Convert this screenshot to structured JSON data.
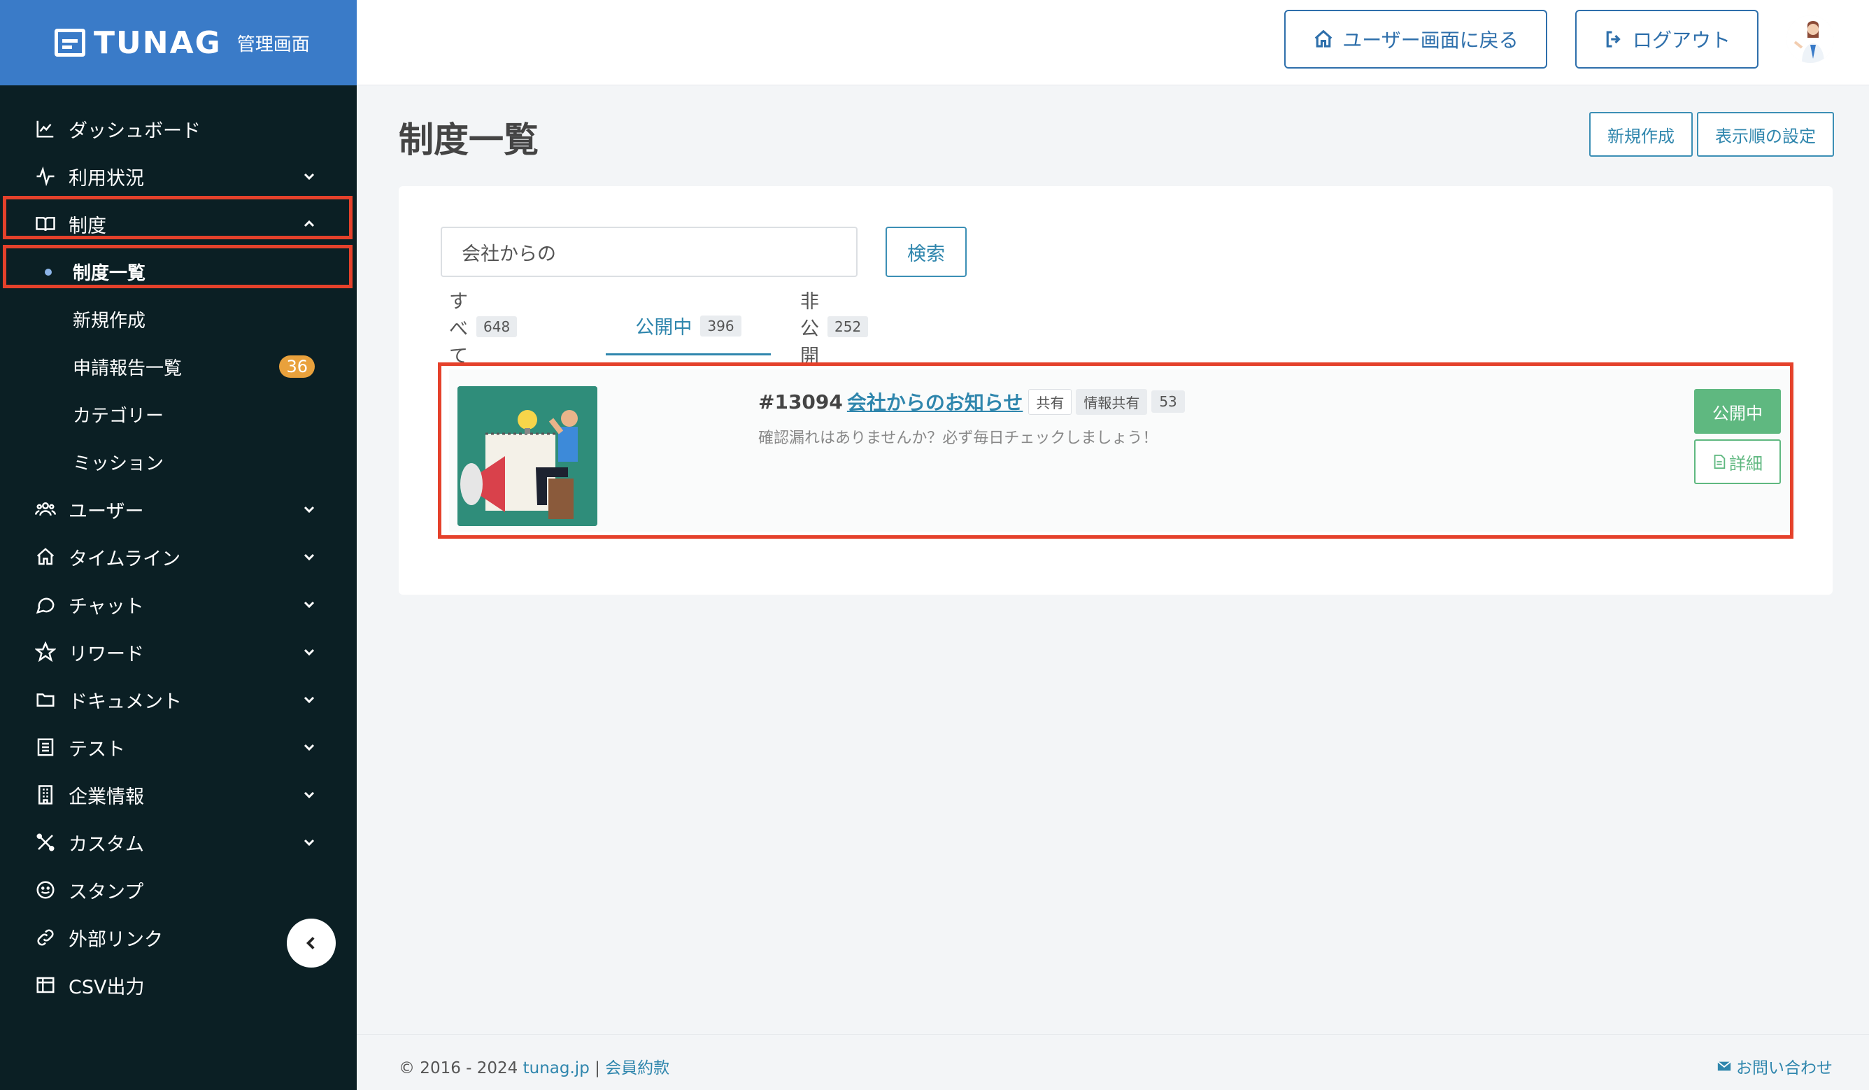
{
  "brand": {
    "name": "TUNAG",
    "subtitle": "管理画面"
  },
  "topbar": {
    "back_label": "ユーザー画面に戻る",
    "logout_label": "ログアウト"
  },
  "sidebar": {
    "items": [
      {
        "label": "ダッシュボード"
      },
      {
        "label": "利用状況"
      },
      {
        "label": "制度"
      },
      {
        "label": "制度一覧"
      },
      {
        "label": "新規作成"
      },
      {
        "label": "申請報告一覧",
        "badge": "36"
      },
      {
        "label": "カテゴリー"
      },
      {
        "label": "ミッション"
      },
      {
        "label": "ユーザー"
      },
      {
        "label": "タイムライン"
      },
      {
        "label": "チャット"
      },
      {
        "label": "リワード"
      },
      {
        "label": "ドキュメント"
      },
      {
        "label": "テスト"
      },
      {
        "label": "企業情報"
      },
      {
        "label": "カスタム"
      },
      {
        "label": "スタンプ"
      },
      {
        "label": "外部リンク"
      },
      {
        "label": "CSV出力"
      }
    ]
  },
  "main": {
    "title": "制度一覧",
    "new_button": "新規作成",
    "order_button": "表示順の設定",
    "search": {
      "value": "会社からの",
      "button": "検索"
    },
    "tabs": [
      {
        "label": "すべて",
        "count": "648"
      },
      {
        "label": "公開中",
        "count": "396"
      },
      {
        "label": "非公開",
        "count": "252"
      }
    ],
    "items": [
      {
        "id": "#13094",
        "title": "会社からのお知らせ",
        "tag1": "共有",
        "tag2": "情報共有",
        "tag3": "53",
        "description": "確認漏れはありませんか？必ず毎日チェックしましょう！",
        "status": "公開中",
        "detail": "詳細"
      }
    ]
  },
  "footer": {
    "copyright": "© 2016 - 2024",
    "site": "tunag.jp",
    "separator": "|",
    "terms": "会員約款",
    "contact": "お問い合わせ"
  },
  "colors": {
    "sidebar_bg": "#0b1f24",
    "header_blue": "#3a7bc8",
    "accent": "#2f86ad",
    "status_green": "#5fb880",
    "highlight_red": "#e5412b",
    "badge_orange": "#e9a13c"
  }
}
